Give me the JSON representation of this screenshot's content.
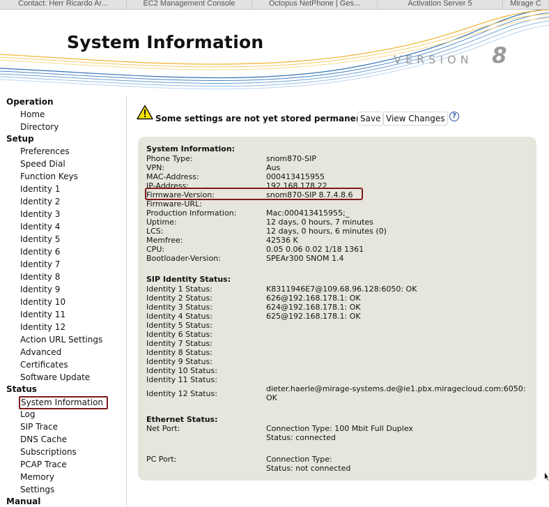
{
  "browser_tabs": [
    "Contact: Herr Ricardo Ar...",
    "EC2 Management Console",
    "Octopus NetPhone | Ges...",
    "Activation Server 5",
    "Mirage C"
  ],
  "header": {
    "title": "System Information",
    "version_word": "VERSION",
    "version_number": "8"
  },
  "sidebar": {
    "operation": {
      "heading": "Operation",
      "items": [
        "Home",
        "Directory"
      ]
    },
    "setup": {
      "heading": "Setup",
      "items": [
        "Preferences",
        "Speed Dial",
        "Function Keys",
        "Identity 1",
        "Identity 2",
        "Identity 3",
        "Identity 4",
        "Identity 5",
        "Identity 6",
        "Identity 7",
        "Identity 8",
        "Identity 9",
        "Identity 10",
        "Identity 11",
        "Identity 12",
        "Action URL Settings",
        "Advanced",
        "Certificates",
        "Software Update"
      ]
    },
    "status": {
      "heading": "Status",
      "items": [
        "System Information",
        "Log",
        "SIP Trace",
        "DNS Cache",
        "Subscriptions",
        "PCAP Trace",
        "Memory",
        "Settings"
      ]
    },
    "manual": {
      "heading": "Manual"
    }
  },
  "notice": {
    "text": "Some settings are not yet stored permanently.",
    "save_label": "Save",
    "view_changes_label": "View Changes",
    "help_label": "?"
  },
  "system_info": {
    "heading": "System Information:",
    "rows": [
      {
        "label": "Phone Type:",
        "value": "snom870-SIP"
      },
      {
        "label": "VPN:",
        "value": "Aus"
      },
      {
        "label": "MAC-Address:",
        "value": "000413415955"
      },
      {
        "label": "IP-Address:",
        "value": "192.168.178.22"
      },
      {
        "label": "Firmware-Version:",
        "value": "snom870-SIP 8.7.4.8.6"
      },
      {
        "label": "Firmware-URL:",
        "value": ""
      },
      {
        "label": "Production Information:",
        "value": "Mac:000413415955;_"
      },
      {
        "label": "Uptime:",
        "value": "12 days, 0 hours, 7 minutes"
      },
      {
        "label": "LCS:",
        "value": "12 days, 0 hours, 6 minutes (0)"
      },
      {
        "label": "Memfree:",
        "value": "42536 K"
      },
      {
        "label": "CPU:",
        "value": "0.05 0.06 0.02 1/18 1361"
      },
      {
        "label": "Bootloader-Version:",
        "value": "SPEAr300 SNOM 1.4"
      }
    ]
  },
  "sip_status": {
    "heading": "SIP Identity Status:",
    "rows": [
      {
        "label": "Identity 1 Status:",
        "value": "K8311946E7@109.68.96.128:6050: OK"
      },
      {
        "label": "Identity 2 Status:",
        "value": "626@192.168.178.1: OK"
      },
      {
        "label": "Identity 3 Status:",
        "value": "624@192.168.178.1: OK"
      },
      {
        "label": "Identity 4 Status:",
        "value": "625@192.168.178.1: OK"
      },
      {
        "label": "Identity 5 Status:",
        "value": ""
      },
      {
        "label": "Identity 6 Status:",
        "value": ""
      },
      {
        "label": "Identity 7 Status:",
        "value": ""
      },
      {
        "label": "Identity 8 Status:",
        "value": ""
      },
      {
        "label": "Identity 9 Status:",
        "value": ""
      },
      {
        "label": "Identity 10 Status:",
        "value": ""
      },
      {
        "label": "Identity 11 Status:",
        "value": ""
      },
      {
        "label": "Identity 12 Status:",
        "value": "dieter.haerle@mirage-systems.de@ie1.pbx.miragecloud.com:6050:",
        "value2": "OK"
      }
    ]
  },
  "ethernet": {
    "heading": "Ethernet Status:",
    "net_port": {
      "label": "Net Port:",
      "line1": "Connection Type: 100 Mbit Full Duplex",
      "line2": "Status: connected"
    },
    "pc_port": {
      "label": "PC Port:",
      "line1": "Connection Type:",
      "line2": "Status: not connected"
    }
  },
  "colors": {
    "panel_bg": "#e7e6dd",
    "highlight_border": "#7e1a1a",
    "help_blue": "#2c52a8",
    "version_grey": "#9a9a9a"
  }
}
